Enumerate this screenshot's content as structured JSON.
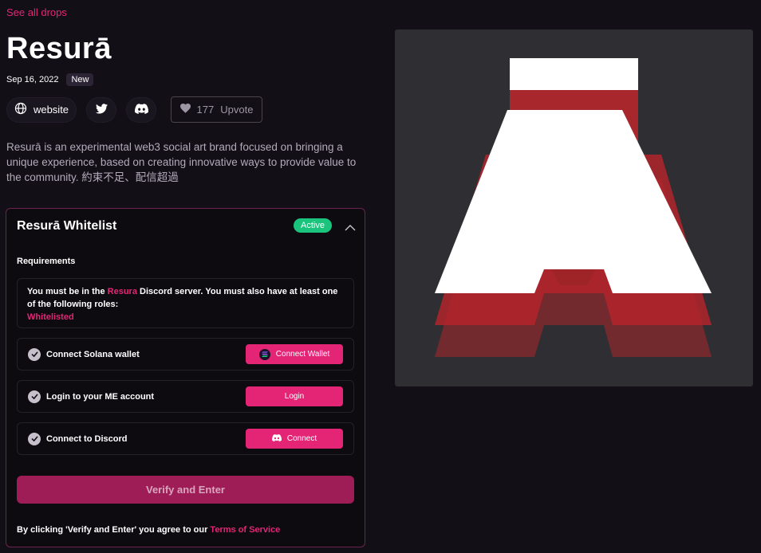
{
  "nav": {
    "see_all": "See all drops"
  },
  "title": "Resurā",
  "meta": {
    "date": "Sep 16, 2022",
    "badge": "New"
  },
  "links": {
    "website": "website",
    "upvote_count": "177",
    "upvote_label": "Upvote"
  },
  "description": "Resurā is an experimental web3 social art brand focused on bringing a unique experience, based on creating innovative ways to provide value to the community. 約束不足、配信超過",
  "panel": {
    "title": "Resurā Whitelist",
    "status": "Active",
    "requirements_label": "Requirements",
    "req_text_1": "You must be in the ",
    "req_link": "Resura",
    "req_text_2": " Discord server. You must also have at least one of the following roles:",
    "req_role": "Whitelisted",
    "rows": [
      {
        "label": "Connect Solana wallet",
        "button": "Connect Wallet"
      },
      {
        "label": "Login to your ME account",
        "button": "Login"
      },
      {
        "label": "Connect to Discord",
        "button": "Connect"
      }
    ],
    "verify": "Verify and Enter",
    "tos_prefix": "By clicking 'Verify and Enter' you agree to our ",
    "tos_link": "Terms of Service"
  },
  "colors": {
    "accent": "#e42575",
    "active": "#1bc47d",
    "background": "#120f17"
  }
}
